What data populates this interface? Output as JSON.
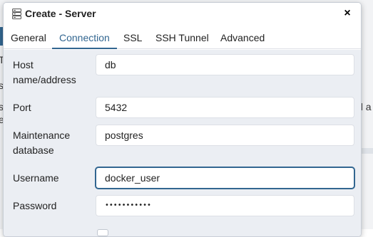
{
  "background": {
    "fragments": [
      "T",
      "s",
      "s",
      "e",
      "al a"
    ]
  },
  "dialog": {
    "title": "Create - Server",
    "close_symbol": "×",
    "title_icon": "server-icon"
  },
  "tabs": [
    {
      "label": "General"
    },
    {
      "label": "Connection"
    },
    {
      "label": "SSL"
    },
    {
      "label": "SSH Tunnel"
    },
    {
      "label": "Advanced"
    }
  ],
  "active_tab": "Connection",
  "form": {
    "host": {
      "label": "Host name/address",
      "value": "db"
    },
    "port": {
      "label": "Port",
      "value": "5432"
    },
    "maintenance_db": {
      "label": "Maintenance database",
      "value": "postgres"
    },
    "username": {
      "label": "Username",
      "value": "docker_user"
    },
    "password": {
      "label": "Password",
      "value": "•••••••••••"
    }
  },
  "colors": {
    "accent": "#326690",
    "form_background": "#ebeef3"
  }
}
